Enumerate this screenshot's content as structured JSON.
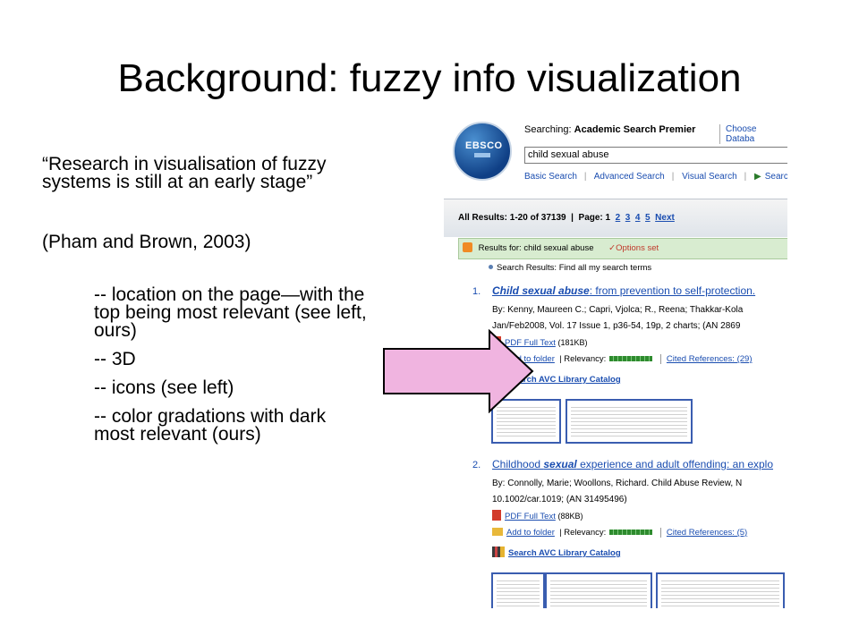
{
  "slide": {
    "title": "Background: fuzzy info visualization",
    "quote": "“Research in visualisation of fuzzy systems is still at an early stage”",
    "citation": "(Pham and Brown, 2003)",
    "bullets": [
      "-- location on the page—with the top being most relevant (see left, ours)",
      "-- 3D",
      "-- icons (see left)",
      "-- color gradations with dark most relevant (ours)"
    ]
  },
  "screenshot": {
    "logo_text": "EBSCO",
    "searching_label": "Searching:",
    "database": "Academic Search Premier",
    "choose_database": "Choose Databa",
    "query": "child sexual abuse",
    "links": [
      "Basic Search",
      "Advanced Search",
      "Visual Search",
      "Search Hi"
    ],
    "results_summary": "All Results: 1-20 of 37139",
    "page_label": "Page: 1",
    "pages": [
      "2",
      "3",
      "4",
      "5"
    ],
    "next_label": "Next",
    "results_for": "Results for: child sexual abuse",
    "options_set": "✓Options set",
    "search_results_label": "Search Results: Find all my search terms",
    "results": [
      {
        "number": "1.",
        "title_em": "Child sexual abuse",
        "title_rest": ": from prevention to self-protection.",
        "byline": "By: Kenny, Maureen C.; Capri, Vjolca; R., Reena; Thakkar-Kola",
        "source": "Jan/Feb2008, Vol. 17 Issue 1, p36-54, 19p, 2 charts; (AN 2869",
        "pdf_label": "PDF Full Text",
        "pdf_size": "(181KB)",
        "folder_label": "Add to folder",
        "relevancy_label": "Relevancy:",
        "cited_label": "Cited References: (29)",
        "avc_label": "Search AVC Library Catalog"
      },
      {
        "number": "2.",
        "title_a": "Childhood ",
        "title_em": "sexual",
        "title_rest": " experience and adult offending: an explo",
        "byline": "By: Connolly, Marie; Woollons, Richard. Child Abuse Review, N",
        "source": "10.1002/car.1019; (AN 31495496)",
        "pdf_label": "PDF Full Text",
        "pdf_size": "(88KB)",
        "folder_label": "Add to folder",
        "relevancy_label": "Relevancy:",
        "cited_label": "Cited References: (5)",
        "avc_label": "Search AVC Library Catalog"
      }
    ]
  },
  "arrow_color": "#f0b4e0"
}
